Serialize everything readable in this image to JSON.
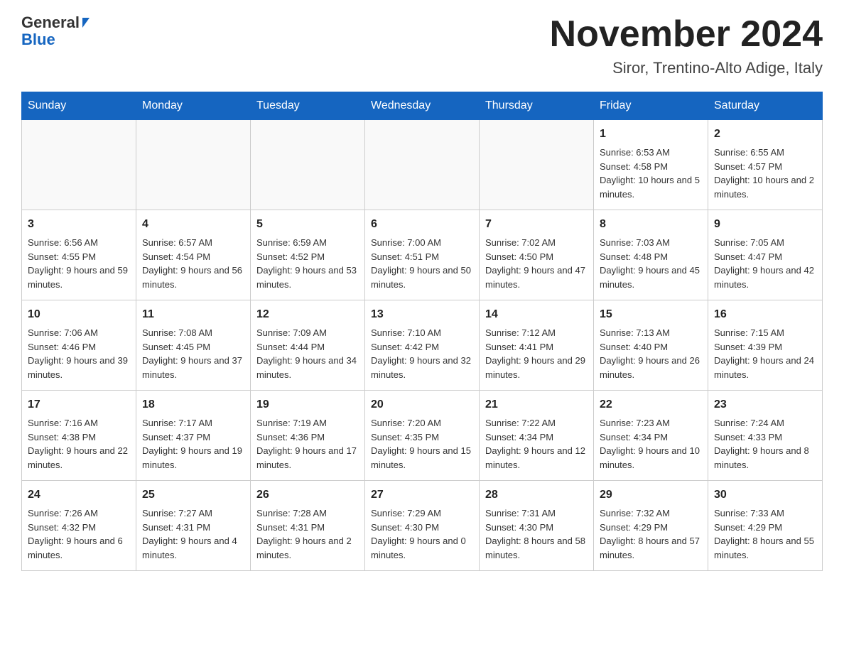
{
  "header": {
    "logo_general": "General",
    "logo_blue": "Blue",
    "month_title": "November 2024",
    "location": "Siror, Trentino-Alto Adige, Italy"
  },
  "days_of_week": [
    "Sunday",
    "Monday",
    "Tuesday",
    "Wednesday",
    "Thursday",
    "Friday",
    "Saturday"
  ],
  "weeks": [
    [
      {
        "day": "",
        "info": ""
      },
      {
        "day": "",
        "info": ""
      },
      {
        "day": "",
        "info": ""
      },
      {
        "day": "",
        "info": ""
      },
      {
        "day": "",
        "info": ""
      },
      {
        "day": "1",
        "info": "Sunrise: 6:53 AM\nSunset: 4:58 PM\nDaylight: 10 hours and 5 minutes."
      },
      {
        "day": "2",
        "info": "Sunrise: 6:55 AM\nSunset: 4:57 PM\nDaylight: 10 hours and 2 minutes."
      }
    ],
    [
      {
        "day": "3",
        "info": "Sunrise: 6:56 AM\nSunset: 4:55 PM\nDaylight: 9 hours and 59 minutes."
      },
      {
        "day": "4",
        "info": "Sunrise: 6:57 AM\nSunset: 4:54 PM\nDaylight: 9 hours and 56 minutes."
      },
      {
        "day": "5",
        "info": "Sunrise: 6:59 AM\nSunset: 4:52 PM\nDaylight: 9 hours and 53 minutes."
      },
      {
        "day": "6",
        "info": "Sunrise: 7:00 AM\nSunset: 4:51 PM\nDaylight: 9 hours and 50 minutes."
      },
      {
        "day": "7",
        "info": "Sunrise: 7:02 AM\nSunset: 4:50 PM\nDaylight: 9 hours and 47 minutes."
      },
      {
        "day": "8",
        "info": "Sunrise: 7:03 AM\nSunset: 4:48 PM\nDaylight: 9 hours and 45 minutes."
      },
      {
        "day": "9",
        "info": "Sunrise: 7:05 AM\nSunset: 4:47 PM\nDaylight: 9 hours and 42 minutes."
      }
    ],
    [
      {
        "day": "10",
        "info": "Sunrise: 7:06 AM\nSunset: 4:46 PM\nDaylight: 9 hours and 39 minutes."
      },
      {
        "day": "11",
        "info": "Sunrise: 7:08 AM\nSunset: 4:45 PM\nDaylight: 9 hours and 37 minutes."
      },
      {
        "day": "12",
        "info": "Sunrise: 7:09 AM\nSunset: 4:44 PM\nDaylight: 9 hours and 34 minutes."
      },
      {
        "day": "13",
        "info": "Sunrise: 7:10 AM\nSunset: 4:42 PM\nDaylight: 9 hours and 32 minutes."
      },
      {
        "day": "14",
        "info": "Sunrise: 7:12 AM\nSunset: 4:41 PM\nDaylight: 9 hours and 29 minutes."
      },
      {
        "day": "15",
        "info": "Sunrise: 7:13 AM\nSunset: 4:40 PM\nDaylight: 9 hours and 26 minutes."
      },
      {
        "day": "16",
        "info": "Sunrise: 7:15 AM\nSunset: 4:39 PM\nDaylight: 9 hours and 24 minutes."
      }
    ],
    [
      {
        "day": "17",
        "info": "Sunrise: 7:16 AM\nSunset: 4:38 PM\nDaylight: 9 hours and 22 minutes."
      },
      {
        "day": "18",
        "info": "Sunrise: 7:17 AM\nSunset: 4:37 PM\nDaylight: 9 hours and 19 minutes."
      },
      {
        "day": "19",
        "info": "Sunrise: 7:19 AM\nSunset: 4:36 PM\nDaylight: 9 hours and 17 minutes."
      },
      {
        "day": "20",
        "info": "Sunrise: 7:20 AM\nSunset: 4:35 PM\nDaylight: 9 hours and 15 minutes."
      },
      {
        "day": "21",
        "info": "Sunrise: 7:22 AM\nSunset: 4:34 PM\nDaylight: 9 hours and 12 minutes."
      },
      {
        "day": "22",
        "info": "Sunrise: 7:23 AM\nSunset: 4:34 PM\nDaylight: 9 hours and 10 minutes."
      },
      {
        "day": "23",
        "info": "Sunrise: 7:24 AM\nSunset: 4:33 PM\nDaylight: 9 hours and 8 minutes."
      }
    ],
    [
      {
        "day": "24",
        "info": "Sunrise: 7:26 AM\nSunset: 4:32 PM\nDaylight: 9 hours and 6 minutes."
      },
      {
        "day": "25",
        "info": "Sunrise: 7:27 AM\nSunset: 4:31 PM\nDaylight: 9 hours and 4 minutes."
      },
      {
        "day": "26",
        "info": "Sunrise: 7:28 AM\nSunset: 4:31 PM\nDaylight: 9 hours and 2 minutes."
      },
      {
        "day": "27",
        "info": "Sunrise: 7:29 AM\nSunset: 4:30 PM\nDaylight: 9 hours and 0 minutes."
      },
      {
        "day": "28",
        "info": "Sunrise: 7:31 AM\nSunset: 4:30 PM\nDaylight: 8 hours and 58 minutes."
      },
      {
        "day": "29",
        "info": "Sunrise: 7:32 AM\nSunset: 4:29 PM\nDaylight: 8 hours and 57 minutes."
      },
      {
        "day": "30",
        "info": "Sunrise: 7:33 AM\nSunset: 4:29 PM\nDaylight: 8 hours and 55 minutes."
      }
    ]
  ]
}
